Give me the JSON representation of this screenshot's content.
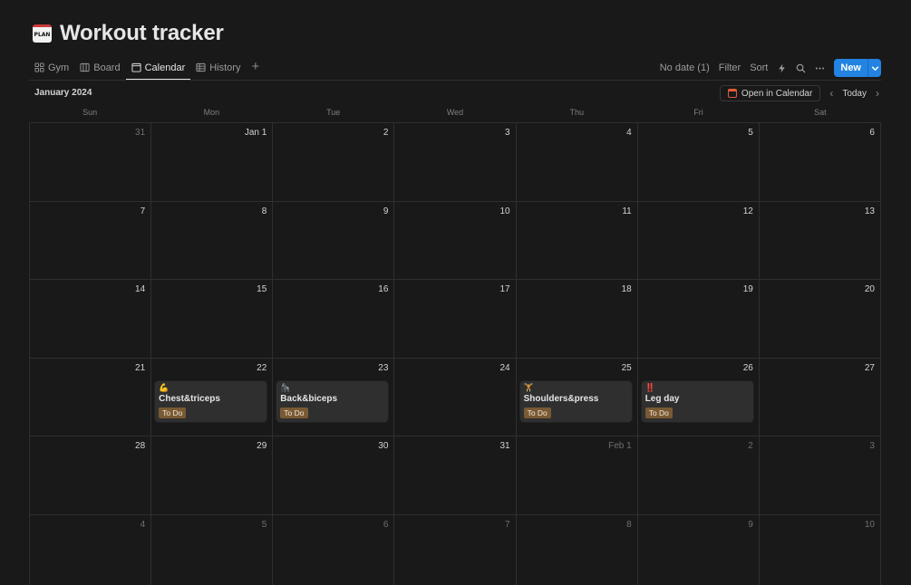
{
  "page": {
    "title": "Workout tracker",
    "icon_text": "PLAN"
  },
  "tabs": [
    {
      "label": "Gym",
      "icon": "gallery-icon",
      "active": false
    },
    {
      "label": "Board",
      "icon": "board-icon",
      "active": false
    },
    {
      "label": "Calendar",
      "icon": "calendar-icon",
      "active": true
    },
    {
      "label": "History",
      "icon": "table-icon",
      "active": false
    }
  ],
  "toolbar": {
    "no_date": "No date (1)",
    "filter": "Filter",
    "sort": "Sort",
    "new_label": "New"
  },
  "calendar": {
    "month_label": "January 2024",
    "open_in_calendar": "Open in Calendar",
    "today": "Today",
    "weekdays": [
      "Sun",
      "Mon",
      "Tue",
      "Wed",
      "Thu",
      "Fri",
      "Sat"
    ],
    "days": [
      {
        "label": "31",
        "muted": true
      },
      {
        "label": "Jan 1",
        "muted": false
      },
      {
        "label": "2",
        "muted": false
      },
      {
        "label": "3",
        "muted": false
      },
      {
        "label": "4",
        "muted": false
      },
      {
        "label": "5",
        "muted": false
      },
      {
        "label": "6",
        "muted": false
      },
      {
        "label": "7",
        "muted": false
      },
      {
        "label": "8",
        "muted": false
      },
      {
        "label": "9",
        "muted": false
      },
      {
        "label": "10",
        "muted": false
      },
      {
        "label": "11",
        "muted": false
      },
      {
        "label": "12",
        "muted": false
      },
      {
        "label": "13",
        "muted": false
      },
      {
        "label": "14",
        "muted": false
      },
      {
        "label": "15",
        "muted": false
      },
      {
        "label": "16",
        "muted": false
      },
      {
        "label": "17",
        "muted": false
      },
      {
        "label": "18",
        "muted": false
      },
      {
        "label": "19",
        "muted": false
      },
      {
        "label": "20",
        "muted": false
      },
      {
        "label": "21",
        "muted": false
      },
      {
        "label": "22",
        "muted": false,
        "event": {
          "emoji": "💪",
          "title": "Chest&triceps",
          "status": "To Do"
        }
      },
      {
        "label": "23",
        "muted": false,
        "event": {
          "emoji": "🦍",
          "title": "Back&biceps",
          "status": "To Do"
        }
      },
      {
        "label": "24",
        "muted": false
      },
      {
        "label": "25",
        "muted": false,
        "event": {
          "emoji": "🏋",
          "title": "Shoulders&press",
          "status": "To Do"
        }
      },
      {
        "label": "26",
        "muted": false,
        "event": {
          "emoji": "‼️",
          "title": "Leg day",
          "status": "To Do"
        }
      },
      {
        "label": "27",
        "muted": false
      },
      {
        "label": "28",
        "muted": false
      },
      {
        "label": "29",
        "muted": false
      },
      {
        "label": "30",
        "muted": false
      },
      {
        "label": "31",
        "muted": false
      },
      {
        "label": "Feb 1",
        "muted": true
      },
      {
        "label": "2",
        "muted": true
      },
      {
        "label": "3",
        "muted": true
      },
      {
        "label": "4",
        "muted": true
      },
      {
        "label": "5",
        "muted": true
      },
      {
        "label": "6",
        "muted": true
      },
      {
        "label": "7",
        "muted": true
      },
      {
        "label": "8",
        "muted": true
      },
      {
        "label": "9",
        "muted": true
      },
      {
        "label": "10",
        "muted": true
      }
    ]
  },
  "colors": {
    "accent": "#2383e2",
    "status_todo": "#7a5a34",
    "background": "#191919"
  }
}
